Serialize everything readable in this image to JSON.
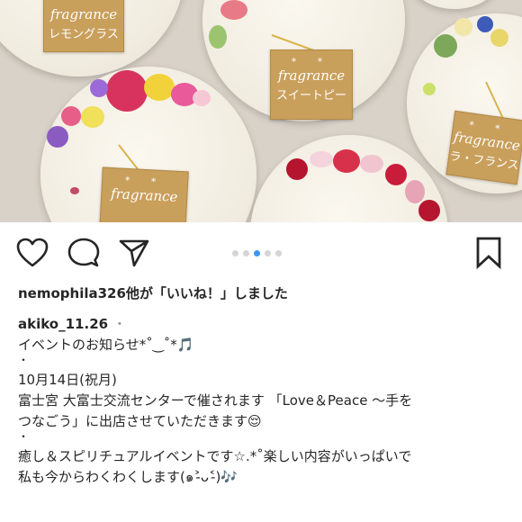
{
  "photo": {
    "tags": [
      {
        "stars": "* *",
        "word": "fragrance",
        "name": "レモングラス"
      },
      {
        "stars": "* *",
        "word": "fragrance",
        "name": "スイートピー"
      },
      {
        "stars": "* *",
        "word": "fragrance",
        "name": "ラ・フランス"
      },
      {
        "stars": "* *",
        "word": "fragrance",
        "name": ""
      }
    ]
  },
  "actions": {
    "like_icon": "heart-icon",
    "comment_icon": "comment-icon",
    "share_icon": "paper-plane-icon",
    "save_icon": "bookmark-icon",
    "carousel_dots": 5,
    "carousel_active": 3
  },
  "likes_text": "nemophila326他が「いいね！」しました",
  "post": {
    "username": "akiko_11.26",
    "more": "・"
  },
  "caption": {
    "line1": "イベントのお知らせ*˚‿˚*🎵",
    "dot1": "・",
    "line2": "10月14日(祝月)",
    "line3": "富士宮 大富士交流センターで催されます 「Love＆Peace 〜手を",
    "line4": "つなごう」に出店させていただきます😌",
    "dot2": "・",
    "line5": "癒し＆スピリチュアルイベントです☆.*˚楽しい内容がいっぱいで",
    "line6": "私も今からわくわくします(๑˃̵ᴗ˂̵)🎶"
  }
}
